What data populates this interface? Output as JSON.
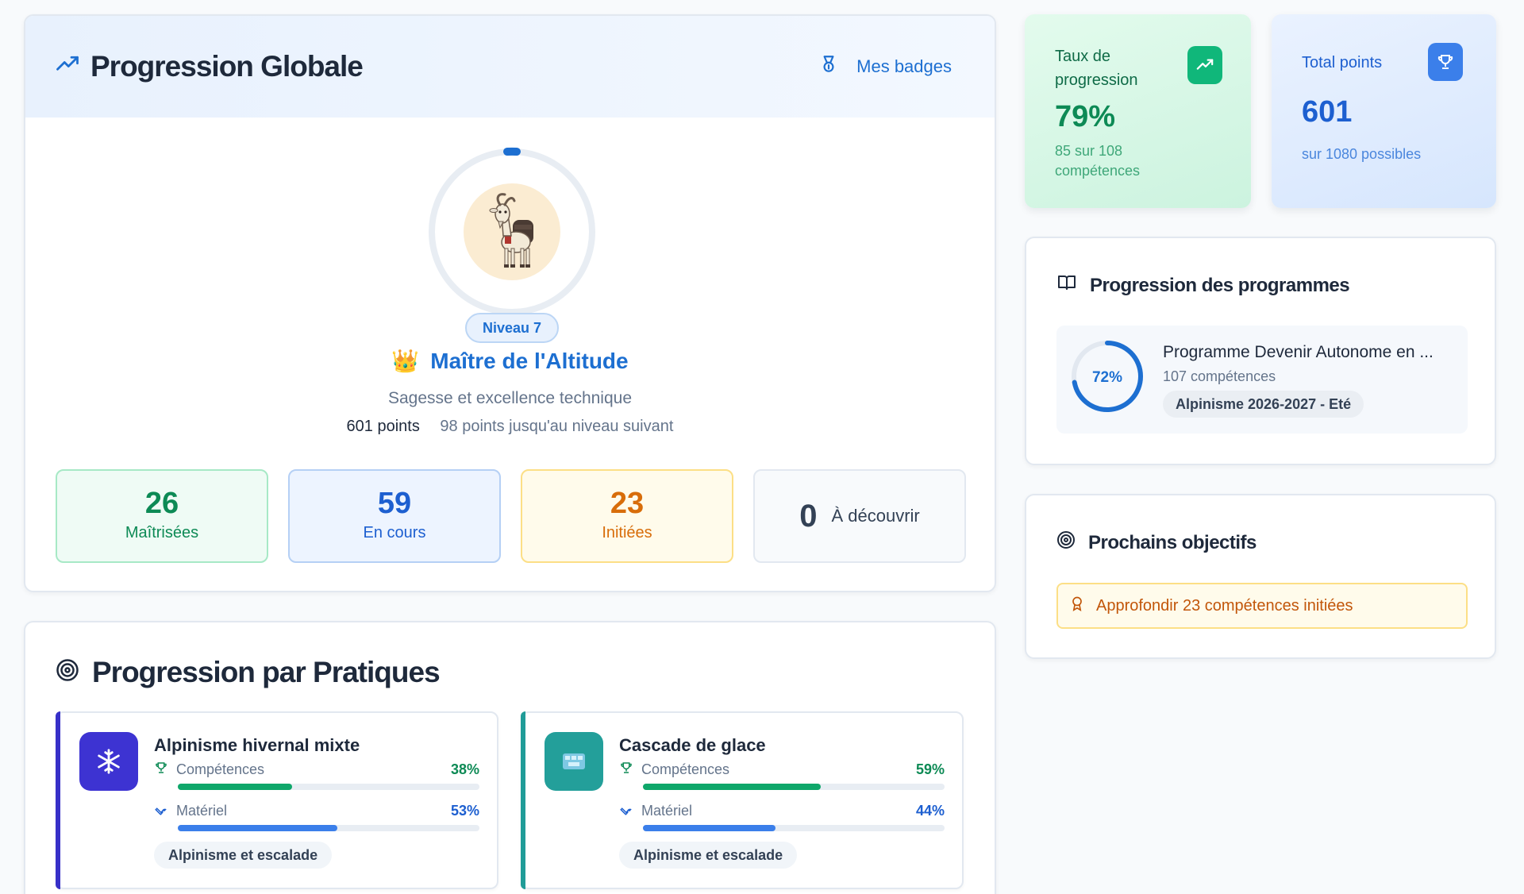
{
  "global": {
    "title": "Progression Globale",
    "badges_link": "Mes badges",
    "level": "Niveau 7",
    "rank_emoji": "👑",
    "rank_title": "Maître de l'Altitude",
    "rank_subtitle": "Sagesse et excellence technique",
    "points": "601 points",
    "next_level": "98 points jusqu'au niveau suivant",
    "stats": [
      {
        "value": "26",
        "label": "Maîtrisées"
      },
      {
        "value": "59",
        "label": "En cours"
      },
      {
        "value": "23",
        "label": "Initiées"
      },
      {
        "value": "0",
        "label": "À découvrir"
      }
    ]
  },
  "pratiques": {
    "title": "Progression par Pratiques",
    "items": [
      {
        "name": "Alpinisme hivernal mixte",
        "icon": "snowflake-icon",
        "comp_label": "Compétences",
        "comp_pct": "38%",
        "comp_value": 38,
        "mat_label": "Matériel",
        "mat_pct": "53%",
        "mat_value": 53,
        "tag": "Alpinisme et escalade"
      },
      {
        "name": "Cascade de glace",
        "icon": "ice-icon",
        "comp_label": "Compétences",
        "comp_pct": "59%",
        "comp_value": 59,
        "mat_label": "Matériel",
        "mat_pct": "44%",
        "mat_value": 44,
        "tag": "Alpinisme et escalade"
      }
    ]
  },
  "kpis": {
    "taux": {
      "label": "Taux de progression",
      "value": "79%",
      "sub": "85 sur 108 compétences"
    },
    "points": {
      "label": "Total points",
      "value": "601",
      "sub": "sur 1080 possibles"
    }
  },
  "programmes": {
    "title": "Progression des programmes",
    "items": [
      {
        "pct": "72%",
        "value": 72,
        "name": "Programme Devenir Autonome en ...",
        "count": "107 compétences",
        "tag": "Alpinisme 2026-2027 - Eté"
      }
    ]
  },
  "objectifs": {
    "title": "Prochains objectifs",
    "items": [
      {
        "text": "Approfondir 23 compétences initiées"
      }
    ]
  },
  "colors": {
    "primary": "#1d6fd1",
    "success": "#0d8a55",
    "warning": "#d86d0a"
  }
}
